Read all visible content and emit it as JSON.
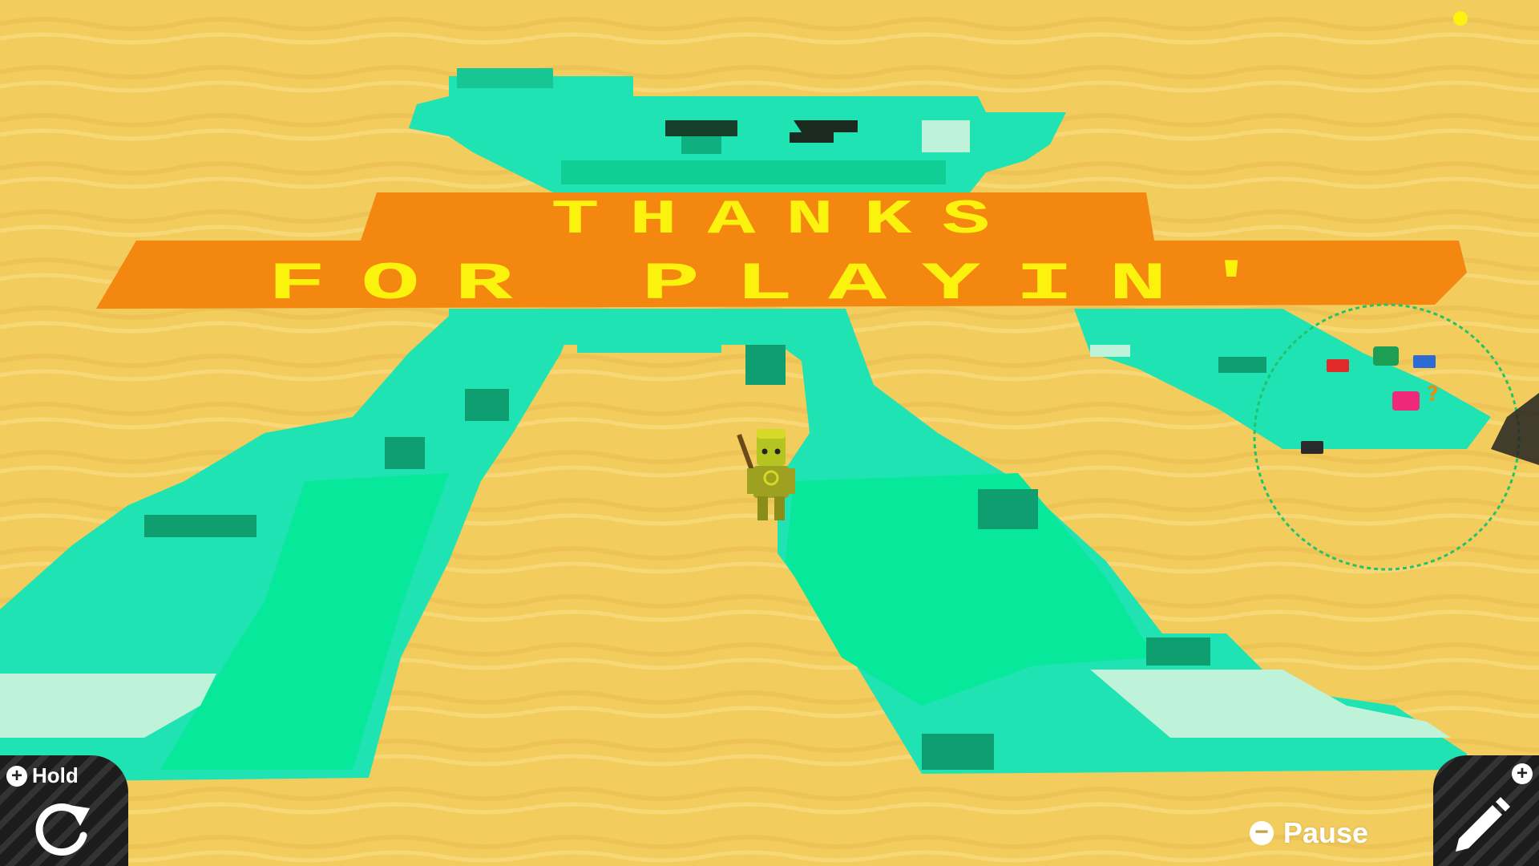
{
  "banner": {
    "line1": "THANKS",
    "line2": "FOR PLAYIN'"
  },
  "hud": {
    "hold_label": "Hold",
    "hold_button_glyph": "+",
    "pause_label": "Pause",
    "pause_button_glyph": "−",
    "edit_button_glyph": "+"
  },
  "icons": {
    "hold": "rotate-arrow-icon",
    "edit": "pencil-icon"
  },
  "colors": {
    "sand": "#f3cc5e",
    "aqua": "#1fe3b3",
    "aqua_dark": "#0fb07f",
    "banner_orange": "#f4870f",
    "banner_yellow": "#fbf30d",
    "radar_green": "#22c36b"
  }
}
